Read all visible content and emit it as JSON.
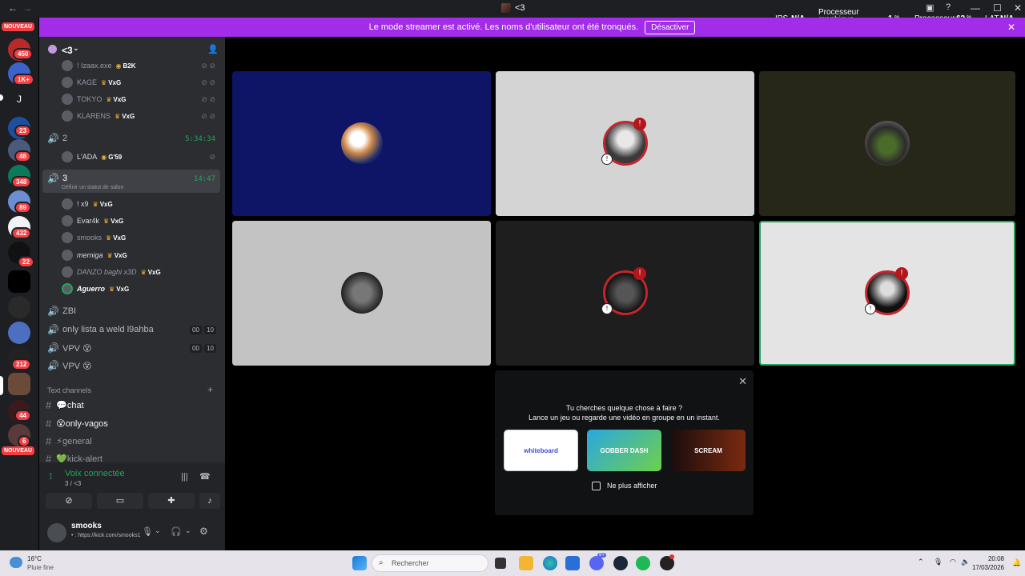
{
  "titlebar": {
    "title": "<3",
    "back": "←",
    "forward": "→",
    "minimize": "—",
    "maximize": "☐",
    "close": "✕"
  },
  "stats": {
    "ips_label": "IPS",
    "ips_value": "N/A",
    "gpu_label_1": "Processeur",
    "gpu_label_2": "graphique",
    "gpu_value": "1",
    "gpu_unit": "%",
    "cpu_label": "Processeur",
    "cpu_value": "62",
    "cpu_unit": "%",
    "lat_label": "LAT",
    "lat_value": "N/A"
  },
  "banner": {
    "text": "Le mode streamer est activé. Les noms d'utilisateur ont été tronqués.",
    "button": "Désactiver"
  },
  "rail": {
    "nouveau_top": "NOUVEAU",
    "badges": [
      "450",
      "1K+",
      "23",
      "48",
      "348",
      "89",
      "432",
      "22",
      "212",
      "44",
      "6"
    ],
    "letter_server": "J",
    "nouveau_bottom": "NOUVEAU"
  },
  "server": {
    "name": "<3"
  },
  "voice": {
    "upper_users": [
      {
        "name": "! Izaax.exe",
        "tag": "B2K"
      },
      {
        "name": "KAGE",
        "tag": "VxG"
      },
      {
        "name": "TOKYO",
        "tag": "VxG"
      },
      {
        "name": "KLARENS",
        "tag": "VxG"
      }
    ],
    "channel_2": {
      "name": "2",
      "timer": "5:34:34",
      "user": "L'ADA",
      "tag": "G'59"
    },
    "channel_3": {
      "name": "3",
      "timer": "14:47",
      "status": "Définir un statut de salon"
    },
    "channel_3_users": [
      {
        "name": "! x9",
        "tag": "VxG"
      },
      {
        "name": "Evar4k",
        "tag": "VxG"
      },
      {
        "name": "smooks",
        "tag": "VxG"
      },
      {
        "name": "merniga",
        "tag": "VxG"
      },
      {
        "name": "DANZO baghi x3D",
        "tag": "VxG"
      },
      {
        "name": "Aguerro",
        "tag": "VxG"
      }
    ],
    "other_channels": [
      {
        "name": "ZBI"
      },
      {
        "name": "only lista a weld l9ahba",
        "n1": "00",
        "n2": "10"
      },
      {
        "name": "VPV 😵",
        "n1": "00",
        "n2": "10"
      },
      {
        "name": "VPV 😵"
      }
    ]
  },
  "text_section": {
    "label": "Text channels",
    "add": "+"
  },
  "text_channels": [
    "💬chat",
    "😵only-vagos",
    "⚡general",
    "💚kick-alert"
  ],
  "voice_panel": {
    "status": "Voix connectée",
    "sub": "3 / <3"
  },
  "user_panel": {
    "name": "smooks",
    "status": "• : https://kick.com/smooks1"
  },
  "activity": {
    "line1": "Tu cherches quelque chose à faire ?",
    "line2": "Lance un jeu ou regarde une vidéo en groupe en un instant.",
    "cards": [
      "whiteboard",
      "GOBBER DASH",
      "SCREAM"
    ],
    "checkbox_label": "Ne plus afficher",
    "close": "✕"
  },
  "taskbar": {
    "temp": "16°C",
    "weather": "Pluie fine",
    "search_placeholder": "Rechercher",
    "time": "20:08",
    "date": "17/03/2026",
    "discord_badge": "9+"
  }
}
